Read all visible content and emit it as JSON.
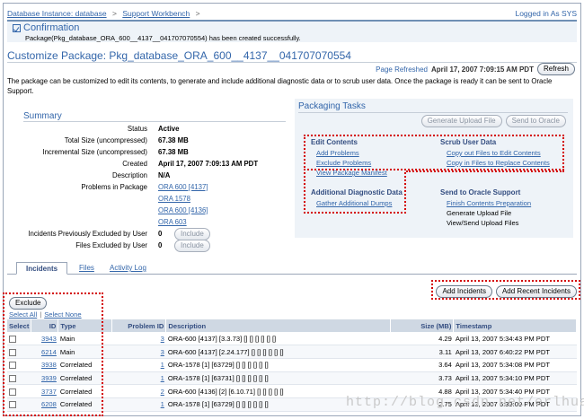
{
  "breadcrumb": {
    "item1": "Database Instance: database",
    "item2": "Support Workbench",
    "trailing_sep": ">",
    "sep": ">"
  },
  "login_text": "Logged in As SYS",
  "confirmation": {
    "title": "Confirmation",
    "message": "Package(Pkg_database_ORA_600__4137__041707070554) has been created successfully."
  },
  "page_title": "Customize Package: Pkg_database_ORA_600__4137__041707070554",
  "refresh": {
    "label": "Page Refreshed",
    "value": "April 17, 2007 7:09:15 AM PDT",
    "button": "Refresh"
  },
  "intro": "The package can be customized to edit its contents, to generate and include additional diagnostic data or to scrub user data. Once the package is ready it can be sent to Oracle Support.",
  "summary": {
    "title": "Summary",
    "status_label": "Status",
    "status_value": "Active",
    "total_size_label": "Total Size (uncompressed)",
    "total_size_value": "67.38 MB",
    "incr_size_label": "Incremental Size (uncompressed)",
    "incr_size_value": "67.38 MB",
    "created_label": "Created",
    "created_value": "April 17, 2007 7:09:13 AM PDT",
    "description_label": "Description",
    "description_value": "N/A",
    "problems_label": "Problems in Package",
    "problems": [
      "ORA 600 [4137]",
      "ORA 1578",
      "ORA 600 [4136]",
      "ORA 603"
    ],
    "incidents_excl_label": "Incidents Previously Excluded by User",
    "incidents_excl_value": "0",
    "files_excl_label": "Files Excluded by User",
    "files_excl_value": "0",
    "include_button": "Include"
  },
  "packaging": {
    "title": "Packaging Tasks",
    "generate_button": "Generate Upload File",
    "send_button": "Send to Oracle",
    "edit_title": "Edit Contents",
    "edit_links": [
      "Add Problems",
      "Exclude Problems",
      "View Package Manifest"
    ],
    "scrub_title": "Scrub User Data",
    "scrub_links": [
      "Copy out Files to Edit Contents",
      "Copy in Files to Replace Contents"
    ],
    "diag_title": "Additional Diagnostic Data",
    "diag_links": [
      "Gather Additional Dumps"
    ],
    "send_title": "Send to Oracle Support",
    "send_link": "Finish Contents Preparation",
    "send_items": [
      "Generate Upload File",
      "View/Send Upload Files"
    ]
  },
  "tabs": [
    "Incidents",
    "Files",
    "Activity Log"
  ],
  "actions": {
    "add_incidents": "Add Incidents",
    "add_recent": "Add Recent Incidents",
    "exclude": "Exclude",
    "select_all": "Select All",
    "select_none": "Select None"
  },
  "table": {
    "headers": [
      "Select",
      "ID",
      "Type",
      "Problem ID",
      "Description",
      "Size (MB)",
      "Timestamp"
    ],
    "rows": [
      {
        "id": "3943",
        "type": "Main",
        "problem_id": "3",
        "description": "ORA-600 [4137] [3.3.73] [] [] [] [] [] []",
        "size": "4.29",
        "timestamp": "April 13, 2007 5:34:43 PM PDT"
      },
      {
        "id": "6214",
        "type": "Main",
        "problem_id": "3",
        "description": "ORA-600 [4137] [2.24.177] [] [] [] [] [] []",
        "size": "3.11",
        "timestamp": "April 13, 2007 6:40:22 PM PDT"
      },
      {
        "id": "3938",
        "type": "Correlated",
        "problem_id": "1",
        "description": "ORA-1578 [1] [63729] [] [] [] [] [] []",
        "size": "3.64",
        "timestamp": "April 13, 2007 5:34:08 PM PDT"
      },
      {
        "id": "3939",
        "type": "Correlated",
        "problem_id": "1",
        "description": "ORA-1578 [1] [63731] [] [] [] [] [] []",
        "size": "3.73",
        "timestamp": "April 13, 2007 5:34:10 PM PDT"
      },
      {
        "id": "3737",
        "type": "Correlated",
        "problem_id": "2",
        "description": "ORA-600 [4136] [2] [6.10.71] [] [] [] [] []",
        "size": "4.88",
        "timestamp": "April 13, 2007 5:34:40 PM PDT"
      },
      {
        "id": "6208",
        "type": "Correlated",
        "problem_id": "1",
        "description": "ORA-1578 [1] [63729] [] [] [] [] [] []",
        "size": "2.75",
        "timestamp": "April 13, 2007 6:39:09 PM PDT"
      }
    ]
  },
  "watermark": "http://blog.csdn.net/erlhua",
  "colors": {
    "link": "#3366aa",
    "highlight": "#d40000",
    "header_bg": "#cfd8e3"
  }
}
